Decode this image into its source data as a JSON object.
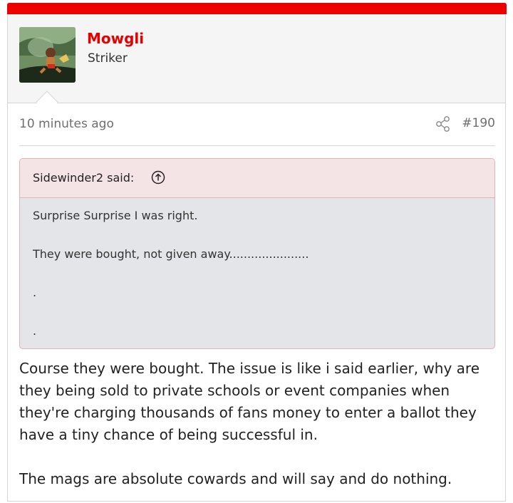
{
  "user": {
    "name": "Mowgli",
    "title": "Striker"
  },
  "post": {
    "time": "10 minutes ago",
    "number": "#190",
    "share_icon": "share-icon"
  },
  "quote": {
    "author_line": "Sidewinder2 said:",
    "jump_icon": "arrow-up-circle-icon",
    "lines": [
      "Surprise Surprise I was right.",
      "They were bought, not given away......................",
      ".",
      "."
    ]
  },
  "message": {
    "paragraphs": [
      "Course they were bought. The issue is like i said earlier, why are they being sold to private schools or event companies when they're charging thousands of fans money to enter a ballot they have a tiny chance of being successful in.",
      "The mags are absolute cowards and will say and do nothing."
    ]
  },
  "colors": {
    "accent": "#ee0000",
    "username": "#e60000",
    "quote_head_bg": "#f5e4e6",
    "quote_body_bg": "#e3e5e8",
    "quote_border": "#e3b2b7"
  }
}
